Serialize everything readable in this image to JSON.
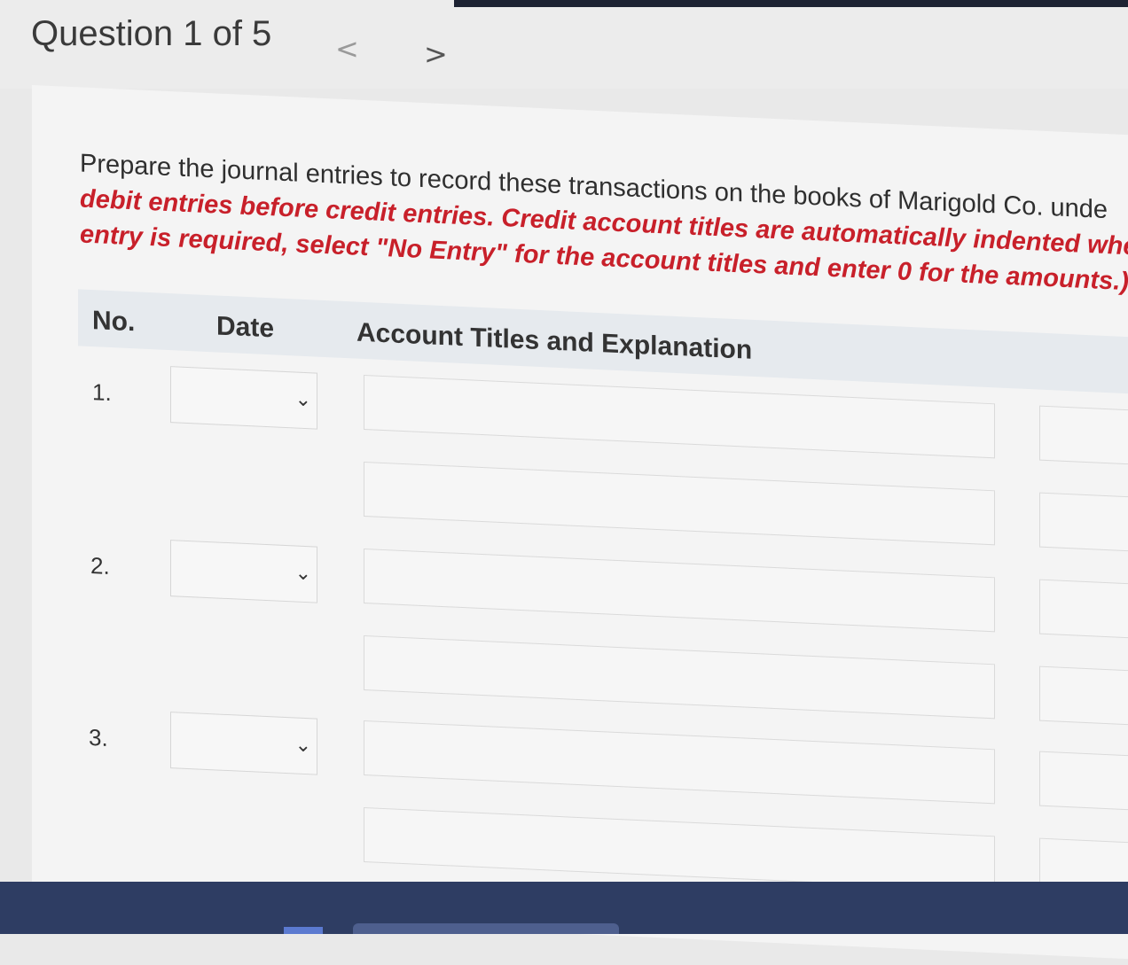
{
  "header": {
    "question_label": "Question 1 of 5",
    "prev_glyph": "<",
    "next_glyph": ">"
  },
  "instructions": {
    "plain_text": "Prepare the journal entries to record these transactions on the books of Marigold Co. unde",
    "red_line_1_tail": "",
    "red_line_2": "debit entries before credit entries. Credit account titles are automatically indented when amount i",
    "red_line_3": "entry is required, select \"No Entry\" for the account titles and enter 0 for the amounts.)"
  },
  "table": {
    "columns": {
      "no": "No.",
      "date": "Date",
      "account": "Account Titles and Explanation"
    },
    "rows": [
      {
        "no": "1."
      },
      {
        "no": "2."
      },
      {
        "no": "3."
      }
    ]
  },
  "colors": {
    "instruction_red": "#c8202a",
    "header_bg": "#e6eaee",
    "taskbar": "#2e3d63"
  },
  "icons": {
    "dropdown": "chevron-down-icon"
  }
}
